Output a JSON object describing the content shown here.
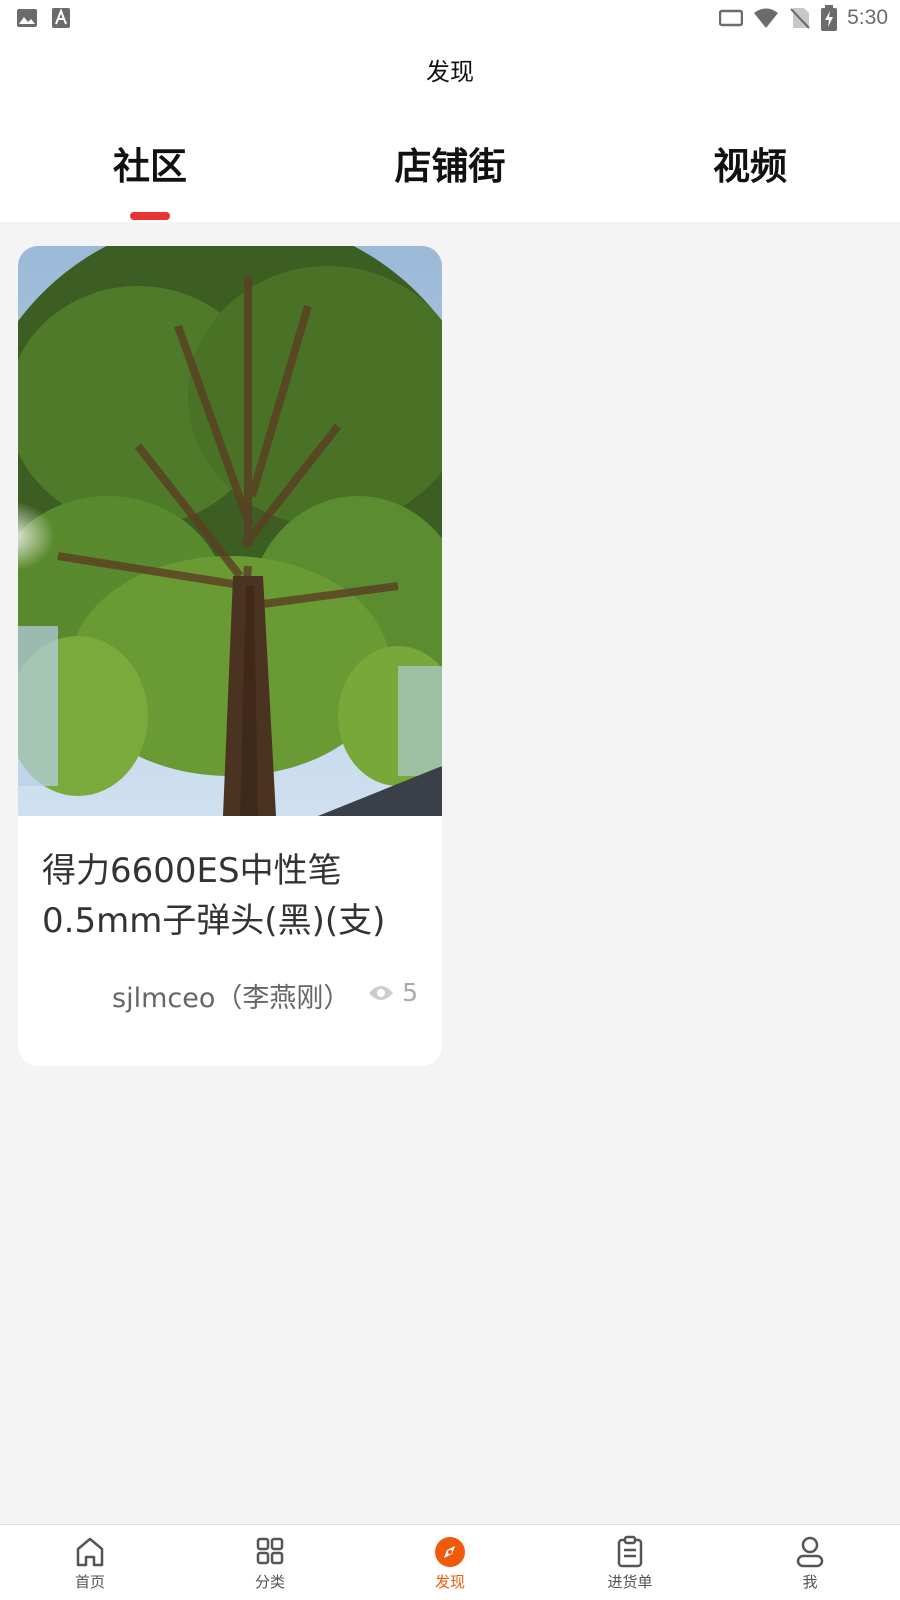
{
  "status_bar": {
    "time": "5:30",
    "left_icons": [
      "image-icon",
      "font-icon"
    ],
    "right_icons": [
      "tablet-icon",
      "wifi-icon",
      "no-sim-icon",
      "battery-charging-icon"
    ]
  },
  "header": {
    "title": "发现",
    "tabs": [
      {
        "label": "社区",
        "active": true
      },
      {
        "label": "店铺街",
        "active": false
      },
      {
        "label": "视频",
        "active": false
      }
    ]
  },
  "feed": {
    "posts": [
      {
        "image": "ginkgo-tree-photo",
        "title": "得力6600ES中性笔0.5mm子弹头(黑)(支)",
        "author": "sjlmceo（李燕刚）",
        "views": "5"
      }
    ]
  },
  "bottom_nav": {
    "items": [
      {
        "label": "首页",
        "icon": "home-icon",
        "active": false
      },
      {
        "label": "分类",
        "icon": "grid-icon",
        "active": false
      },
      {
        "label": "发现",
        "icon": "compass-icon",
        "active": true
      },
      {
        "label": "进货单",
        "icon": "clipboard-icon",
        "active": false
      },
      {
        "label": "我",
        "icon": "user-icon",
        "active": false
      }
    ]
  },
  "colors": {
    "accent_red": "#e93232",
    "active_orange": "#f15a0a",
    "background": "#f4f4f4"
  }
}
